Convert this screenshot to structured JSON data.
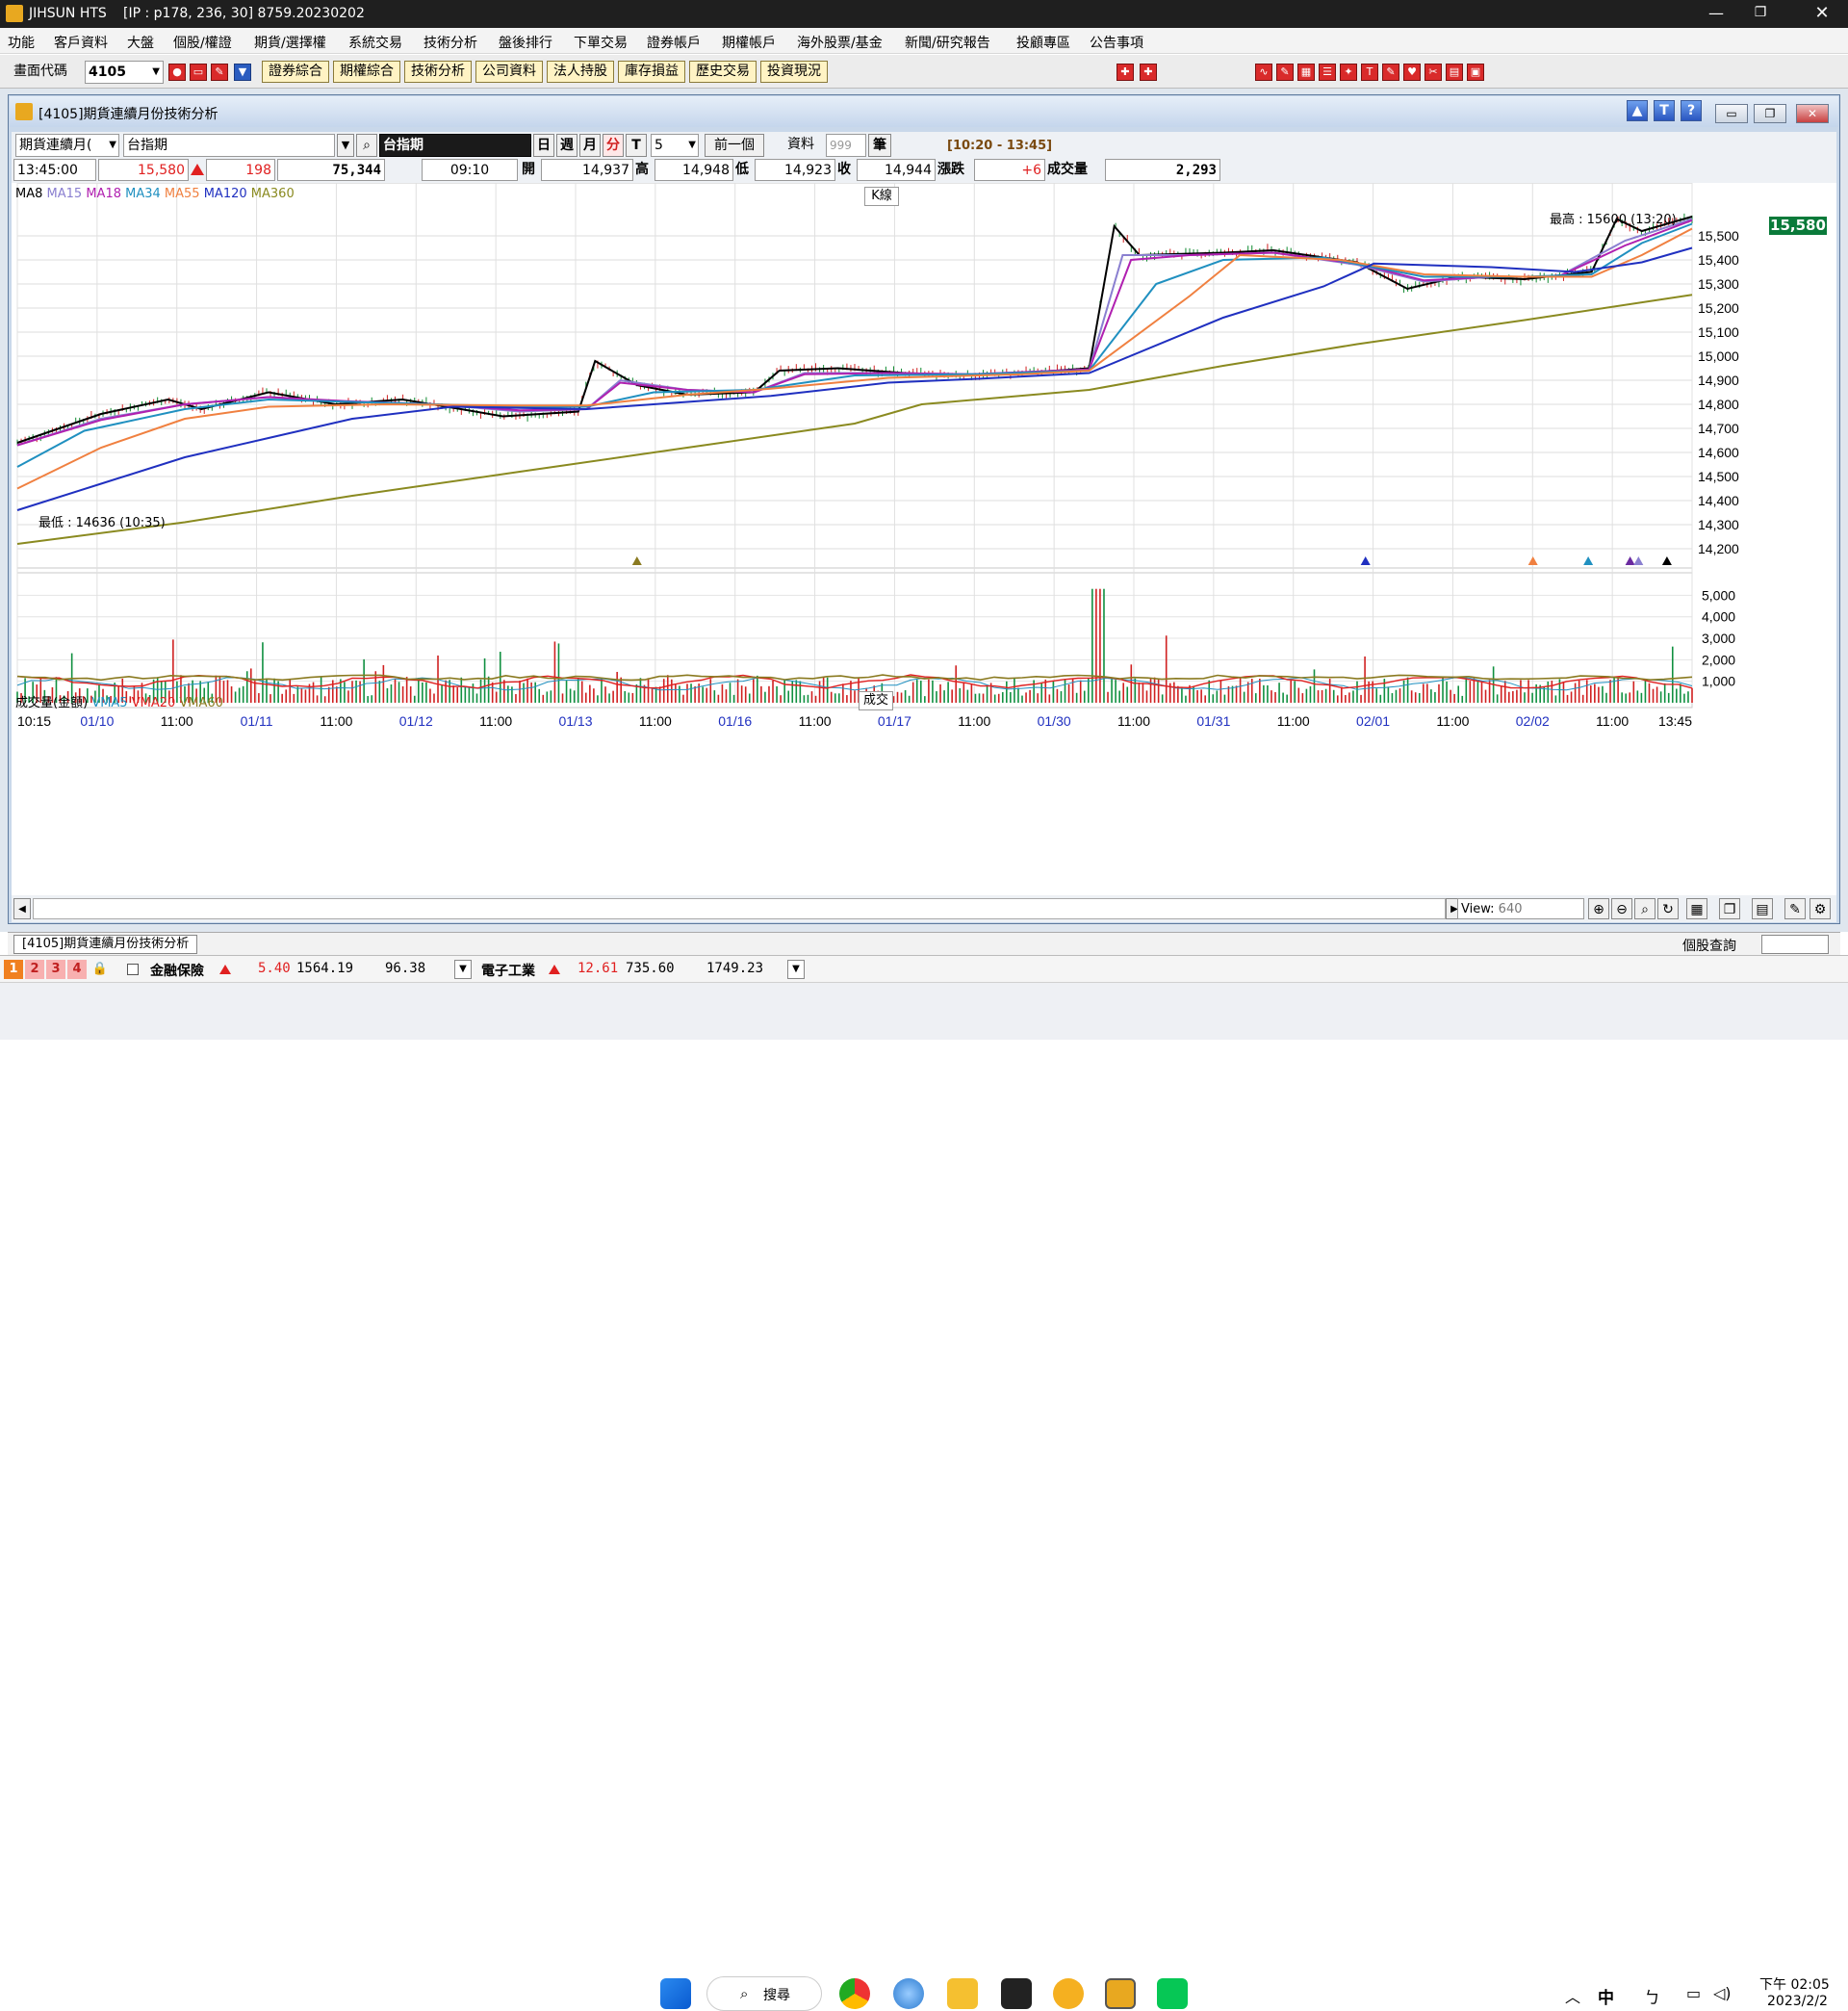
{
  "app": {
    "name": "JIHSUN HTS",
    "ip": "[IP : p178, 236, 30] 8759.20230202"
  },
  "menu": [
    "功能",
    "客戶資料",
    "大盤",
    "個股/權證",
    "期貨/選擇權",
    "系統交易",
    "技術分析",
    "盤後排行",
    "下單交易",
    "證券帳戶",
    "期權帳戶",
    "海外股票/基金",
    "新聞/研究報告",
    "投顧專區",
    "公告事項"
  ],
  "toolbar": {
    "code_label": "畫面代碼",
    "code_value": "4105",
    "buttons": [
      "證券綜合",
      "期權綜合",
      "技術分析",
      "公司資料",
      "法人持股",
      "庫存損益",
      "歷史交易",
      "投資現況"
    ]
  },
  "window": {
    "title": "[4105]期貨連續月份技術分析"
  },
  "controls": {
    "type_select": "期貨連續月(",
    "symbol_input": "台指期",
    "symbol_display": "台指期",
    "periods": [
      "日",
      "週",
      "月",
      "分",
      "T"
    ],
    "interval": "5",
    "prev_button": "前一個",
    "data_label": "資料",
    "data_count": "999",
    "data_unit": "筆",
    "range": "[10:20 - 13:45]"
  },
  "quote": {
    "time": "13:45:00",
    "price": "15,580",
    "change": "198",
    "volume_total": "75,344",
    "open_time": "09:10",
    "open_label": "開",
    "open": "14,937",
    "high_label": "高",
    "high": "14,948",
    "low_label": "低",
    "low": "14,923",
    "close_label": "收",
    "close": "14,944",
    "chg_label": "漲跌",
    "chg": "+6",
    "vol_label": "成交量",
    "vol": "2,293"
  },
  "legend": {
    "ma": [
      {
        "name": "MA8",
        "color": "#000000"
      },
      {
        "name": "MA15",
        "color": "#8a7fd0"
      },
      {
        "name": "MA18",
        "color": "#b020b0"
      },
      {
        "name": "MA34",
        "color": "#2090c0"
      },
      {
        "name": "MA55",
        "color": "#f08040"
      },
      {
        "name": "MA120",
        "color": "#2030c0"
      },
      {
        "name": "MA360",
        "color": "#8a8a20"
      }
    ],
    "vol": [
      {
        "name": "成交量(金額)",
        "color": "#000000"
      },
      {
        "name": "VMA5",
        "color": "#2090c0"
      },
      {
        "name": "VMA20",
        "color": "#e02020"
      },
      {
        "name": "VMA60",
        "color": "#8a7a20"
      }
    ],
    "k_label": "K線",
    "vol_panel_label": "成交"
  },
  "annotations": {
    "high": "最高 : 15600 (13:20)",
    "low": "最低 : 14636 (10:35)"
  },
  "chart_data": {
    "type": "line",
    "x_labels": [
      "10:15",
      "01/10",
      "11:00",
      "01/11",
      "11:00",
      "01/12",
      "11:00",
      "01/13",
      "11:00",
      "01/16",
      "11:00",
      "01/17",
      "11:00",
      "01/30",
      "11:00",
      "01/31",
      "11:00",
      "02/01",
      "11:00",
      "02/02",
      "11:00",
      "13:45"
    ],
    "price_ticks": [
      "15,500",
      "15,400",
      "15,300",
      "15,200",
      "15,100",
      "15,000",
      "14,900",
      "14,800",
      "14,700",
      "14,600",
      "14,500",
      "14,400",
      "14,300",
      "14,200"
    ],
    "price_ylim": [
      14140,
      15680
    ],
    "last_price_badge": "15,580",
    "volume_ticks": [
      "5,000",
      "4,000",
      "3,000",
      "2,000",
      "1,000"
    ],
    "volume_ylim": [
      0,
      5600
    ],
    "series": [
      {
        "name": "MA8",
        "color": "#000000",
        "points": [
          [
            0,
            14640
          ],
          [
            0.05,
            14760
          ],
          [
            0.09,
            14820
          ],
          [
            0.11,
            14780
          ],
          [
            0.15,
            14850
          ],
          [
            0.19,
            14800
          ],
          [
            0.23,
            14820
          ],
          [
            0.265,
            14780
          ],
          [
            0.29,
            14750
          ],
          [
            0.335,
            14770
          ],
          [
            0.345,
            14980
          ],
          [
            0.37,
            14880
          ],
          [
            0.4,
            14840
          ],
          [
            0.44,
            14850
          ],
          [
            0.455,
            14940
          ],
          [
            0.49,
            14950
          ],
          [
            0.53,
            14930
          ],
          [
            0.57,
            14920
          ],
          [
            0.62,
            14940
          ],
          [
            0.64,
            14950
          ],
          [
            0.655,
            15540
          ],
          [
            0.67,
            15420
          ],
          [
            0.72,
            15430
          ],
          [
            0.75,
            15440
          ],
          [
            0.8,
            15390
          ],
          [
            0.83,
            15280
          ],
          [
            0.86,
            15330
          ],
          [
            0.9,
            15320
          ],
          [
            0.94,
            15350
          ],
          [
            0.955,
            15570
          ],
          [
            0.97,
            15520
          ],
          [
            1.0,
            15580
          ]
        ]
      },
      {
        "name": "MA15",
        "color": "#8a7fd0",
        "points": [
          [
            0,
            14630
          ],
          [
            0.05,
            14740
          ],
          [
            0.1,
            14800
          ],
          [
            0.15,
            14830
          ],
          [
            0.2,
            14810
          ],
          [
            0.25,
            14800
          ],
          [
            0.3,
            14770
          ],
          [
            0.34,
            14780
          ],
          [
            0.36,
            14900
          ],
          [
            0.4,
            14860
          ],
          [
            0.44,
            14850
          ],
          [
            0.47,
            14930
          ],
          [
            0.52,
            14930
          ],
          [
            0.57,
            14925
          ],
          [
            0.64,
            14945
          ],
          [
            0.66,
            15420
          ],
          [
            0.7,
            15420
          ],
          [
            0.75,
            15430
          ],
          [
            0.8,
            15380
          ],
          [
            0.84,
            15310
          ],
          [
            0.88,
            15330
          ],
          [
            0.92,
            15330
          ],
          [
            0.96,
            15480
          ],
          [
            1.0,
            15570
          ]
        ]
      },
      {
        "name": "MA18",
        "color": "#b020b0",
        "points": [
          [
            0,
            14630
          ],
          [
            0.05,
            14735
          ],
          [
            0.1,
            14800
          ],
          [
            0.15,
            14830
          ],
          [
            0.2,
            14812
          ],
          [
            0.25,
            14800
          ],
          [
            0.3,
            14775
          ],
          [
            0.34,
            14780
          ],
          [
            0.36,
            14890
          ],
          [
            0.4,
            14860
          ],
          [
            0.44,
            14850
          ],
          [
            0.47,
            14925
          ],
          [
            0.52,
            14930
          ],
          [
            0.57,
            14925
          ],
          [
            0.64,
            14945
          ],
          [
            0.665,
            15400
          ],
          [
            0.7,
            15420
          ],
          [
            0.75,
            15430
          ],
          [
            0.8,
            15385
          ],
          [
            0.84,
            15315
          ],
          [
            0.88,
            15330
          ],
          [
            0.92,
            15330
          ],
          [
            0.96,
            15460
          ],
          [
            1.0,
            15565
          ]
        ]
      },
      {
        "name": "MA34",
        "color": "#2090c0",
        "points": [
          [
            0,
            14540
          ],
          [
            0.04,
            14690
          ],
          [
            0.1,
            14780
          ],
          [
            0.15,
            14820
          ],
          [
            0.2,
            14810
          ],
          [
            0.3,
            14790
          ],
          [
            0.34,
            14790
          ],
          [
            0.38,
            14850
          ],
          [
            0.44,
            14860
          ],
          [
            0.5,
            14920
          ],
          [
            0.57,
            14925
          ],
          [
            0.64,
            14940
          ],
          [
            0.68,
            15300
          ],
          [
            0.72,
            15400
          ],
          [
            0.78,
            15410
          ],
          [
            0.84,
            15330
          ],
          [
            0.9,
            15330
          ],
          [
            0.94,
            15340
          ],
          [
            0.97,
            15470
          ],
          [
            1.0,
            15550
          ]
        ]
      },
      {
        "name": "MA55",
        "color": "#f08040",
        "points": [
          [
            0,
            14450
          ],
          [
            0.05,
            14620
          ],
          [
            0.1,
            14740
          ],
          [
            0.15,
            14790
          ],
          [
            0.22,
            14800
          ],
          [
            0.3,
            14795
          ],
          [
            0.34,
            14795
          ],
          [
            0.4,
            14840
          ],
          [
            0.45,
            14865
          ],
          [
            0.52,
            14910
          ],
          [
            0.6,
            14925
          ],
          [
            0.64,
            14940
          ],
          [
            0.7,
            15250
          ],
          [
            0.73,
            15420
          ],
          [
            0.79,
            15400
          ],
          [
            0.84,
            15340
          ],
          [
            0.9,
            15330
          ],
          [
            0.94,
            15330
          ],
          [
            0.97,
            15420
          ],
          [
            1.0,
            15530
          ]
        ]
      },
      {
        "name": "MA120",
        "color": "#2030c0",
        "points": [
          [
            0,
            14360
          ],
          [
            0.05,
            14470
          ],
          [
            0.1,
            14580
          ],
          [
            0.15,
            14660
          ],
          [
            0.2,
            14740
          ],
          [
            0.26,
            14790
          ],
          [
            0.34,
            14780
          ],
          [
            0.4,
            14810
          ],
          [
            0.45,
            14835
          ],
          [
            0.52,
            14890
          ],
          [
            0.57,
            14905
          ],
          [
            0.64,
            14930
          ],
          [
            0.72,
            15160
          ],
          [
            0.78,
            15290
          ],
          [
            0.81,
            15385
          ],
          [
            0.88,
            15370
          ],
          [
            0.93,
            15350
          ],
          [
            0.97,
            15390
          ],
          [
            1.0,
            15450
          ]
        ]
      },
      {
        "name": "MA360",
        "color": "#8a8a20",
        "points": [
          [
            0,
            14220
          ],
          [
            0.1,
            14310
          ],
          [
            0.2,
            14420
          ],
          [
            0.3,
            14520
          ],
          [
            0.4,
            14620
          ],
          [
            0.5,
            14720
          ],
          [
            0.54,
            14800
          ],
          [
            0.64,
            14860
          ],
          [
            0.72,
            14960
          ],
          [
            0.8,
            15050
          ],
          [
            0.9,
            15150
          ],
          [
            1.0,
            15255
          ]
        ]
      }
    ],
    "volume_series": [
      {
        "name": "VMA5",
        "color": "#2090c0"
      },
      {
        "name": "VMA20",
        "color": "#e02020"
      },
      {
        "name": "VMA60",
        "color": "#8a7a20"
      }
    ]
  },
  "scroll": {
    "view_label": "View:",
    "view_value": "640"
  },
  "bottom_tab": {
    "label": "[4105]期貨連續月份技術分析",
    "right_label": "個股查詢"
  },
  "ticker": {
    "tabs": [
      "1",
      "2",
      "3",
      "4"
    ],
    "item1": {
      "name": "金融保險",
      "change": "5.40",
      "index": "1564.19",
      "vol": "96.38"
    },
    "item2": {
      "name": "電子工業",
      "change": "12.61",
      "index": "735.60",
      "vol": "1749.23"
    }
  },
  "taskbar": {
    "search": "搜尋",
    "ime": "中",
    "time": "下午 02:05",
    "date": "2023/2/2"
  }
}
